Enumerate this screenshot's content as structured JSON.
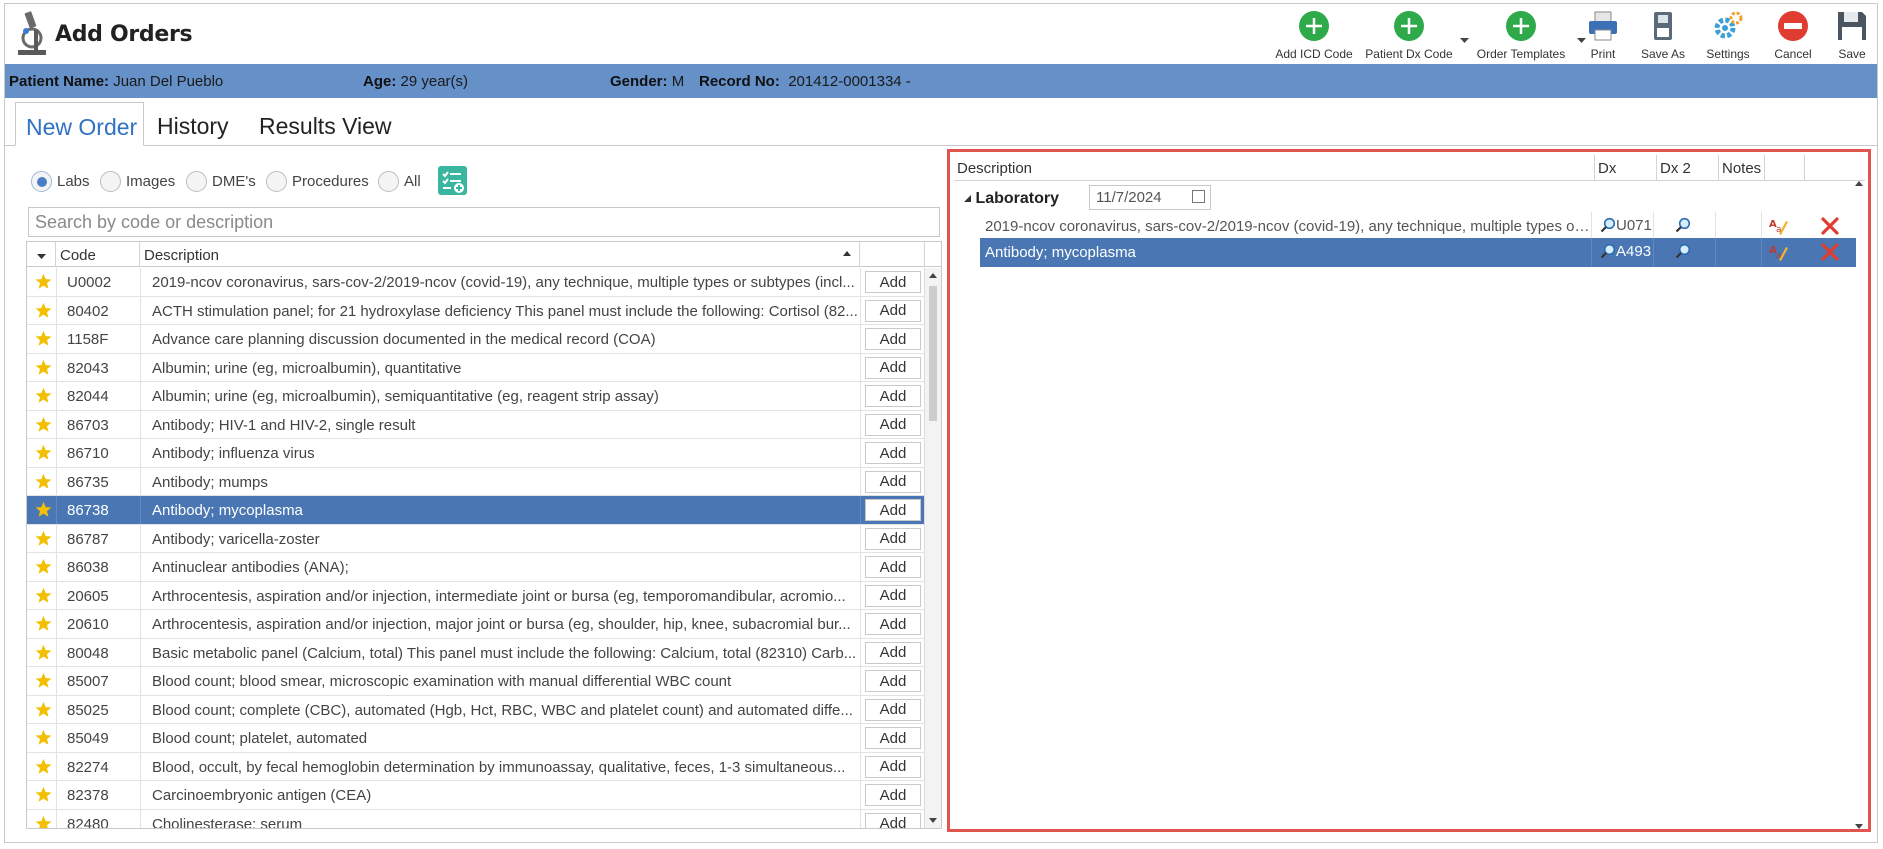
{
  "app": {
    "title": "Add Orders"
  },
  "toolbar": [
    {
      "label": "Add ICD Code",
      "icon": "plus-circle-icon",
      "color": "#2eaa4a",
      "dropdown": false
    },
    {
      "label": "Patient Dx Code",
      "icon": "plus-circle-icon",
      "color": "#2eaa4a",
      "dropdown": true
    },
    {
      "label": "Order Templates",
      "icon": "plus-circle-icon",
      "color": "#2eaa4a",
      "dropdown": true
    },
    {
      "label": "Print",
      "icon": "printer-icon",
      "color": "#3b6fb6",
      "dropdown": false
    },
    {
      "label": "Save As",
      "icon": "save-as-icon",
      "color": "#5a6a7a",
      "dropdown": false
    },
    {
      "label": "Settings",
      "icon": "gear-icon",
      "color": "#3aa0d8",
      "dropdown": false
    },
    {
      "label": "Cancel",
      "icon": "cancel-icon",
      "color": "#e03c31",
      "dropdown": false
    },
    {
      "label": "Save",
      "icon": "floppy-disk-icon",
      "color": "#4a5560",
      "dropdown": false
    }
  ],
  "patient": {
    "name_label": "Patient Name:",
    "name": "Juan Del Pueblo",
    "age_label": "Age:",
    "age": "29 year(s)",
    "gender_label": "Gender:",
    "gender": "M",
    "record_label": "Record No:",
    "record": "201412-0001334 -"
  },
  "tabs": [
    {
      "label": "New Order",
      "active": true
    },
    {
      "label": "History",
      "active": false
    },
    {
      "label": "Results View",
      "active": false
    }
  ],
  "filters": [
    {
      "label": "Labs",
      "selected": true
    },
    {
      "label": "Images",
      "selected": false
    },
    {
      "label": "DME's",
      "selected": false
    },
    {
      "label": "Procedures",
      "selected": false
    },
    {
      "label": "All",
      "selected": false
    }
  ],
  "search": {
    "placeholder": "Search by code or description"
  },
  "grid": {
    "headers": {
      "code": "Code",
      "description": "Description"
    },
    "add_label": "Add",
    "rows": [
      {
        "code": "U0002",
        "description": "2019-ncov coronavirus, sars-cov-2/2019-ncov (covid-19), any technique, multiple types or subtypes (incl...",
        "selected": false
      },
      {
        "code": "80402",
        "description": "ACTH stimulation panel; for 21 hydroxylase deficiency This panel must include the following: Cortisol (82...",
        "selected": false
      },
      {
        "code": "1158F",
        "description": "Advance care planning discussion documented in the medical record (COA)",
        "selected": false
      },
      {
        "code": "82043",
        "description": "Albumin; urine (eg, microalbumin), quantitative",
        "selected": false
      },
      {
        "code": "82044",
        "description": "Albumin; urine (eg, microalbumin), semiquantitative (eg, reagent strip assay)",
        "selected": false
      },
      {
        "code": "86703",
        "description": "Antibody; HIV-1 and HIV-2, single result",
        "selected": false
      },
      {
        "code": "86710",
        "description": "Antibody; influenza virus",
        "selected": false
      },
      {
        "code": "86735",
        "description": "Antibody; mumps",
        "selected": false
      },
      {
        "code": "86738",
        "description": "Antibody; mycoplasma",
        "selected": true
      },
      {
        "code": "86787",
        "description": "Antibody; varicella-zoster",
        "selected": false
      },
      {
        "code": "86038",
        "description": "Antinuclear antibodies (ANA);",
        "selected": false
      },
      {
        "code": "20605",
        "description": "Arthrocentesis, aspiration and/or injection, intermediate joint or bursa (eg, temporomandibular, acromio...",
        "selected": false
      },
      {
        "code": "20610",
        "description": "Arthrocentesis, aspiration and/or injection, major joint or bursa (eg, shoulder, hip, knee, subacromial bur...",
        "selected": false
      },
      {
        "code": "80048",
        "description": "Basic metabolic panel (Calcium, total) This panel must include the following: Calcium, total (82310) Carb...",
        "selected": false
      },
      {
        "code": "85007",
        "description": "Blood count; blood smear, microscopic examination with manual differential WBC count",
        "selected": false
      },
      {
        "code": "85025",
        "description": "Blood count; complete (CBC), automated (Hgb, Hct, RBC, WBC and platelet count) and automated diffe...",
        "selected": false
      },
      {
        "code": "85049",
        "description": "Blood count; platelet, automated",
        "selected": false
      },
      {
        "code": "82274",
        "description": "Blood, occult, by fecal hemoglobin determination by immunoassay, qualitative, feces, 1-3 simultaneous...",
        "selected": false
      },
      {
        "code": "82378",
        "description": "Carcinoembryonic antigen (CEA)",
        "selected": false
      },
      {
        "code": "82480",
        "description": "Cholinesterase; serum",
        "selected": false
      }
    ]
  },
  "orders": {
    "headers": {
      "description": "Description",
      "dx": "Dx",
      "dx2": "Dx 2",
      "notes": "Notes"
    },
    "group": {
      "name": "Laboratory",
      "date": "11/7/2024"
    },
    "items": [
      {
        "description": "2019-ncov coronavirus, sars-cov-2/2019-ncov (covid-19), any technique, multiple types or...",
        "dx": "U071",
        "selected": false
      },
      {
        "description": "Antibody; mycoplasma",
        "dx": "A493",
        "selected": true
      }
    ]
  }
}
